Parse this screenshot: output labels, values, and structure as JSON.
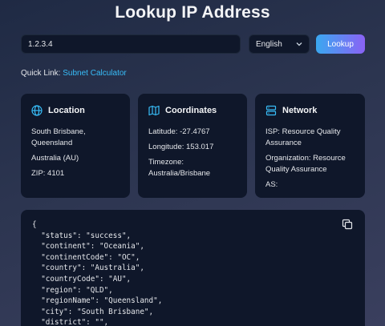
{
  "page": {
    "title": "Lookup IP Address"
  },
  "search": {
    "value": "1.2.3.4",
    "language": "English",
    "button_label": "Lookup"
  },
  "quick_link": {
    "prefix": "Quick Link:",
    "link_text": "Subnet Calculator"
  },
  "cards": {
    "location": {
      "title": "Location",
      "city_region": "South Brisbane, Queensland",
      "country": "Australia (AU)",
      "zip": "ZIP: 4101"
    },
    "coordinates": {
      "title": "Coordinates",
      "latitude": "Latitude: -27.4767",
      "longitude": "Longitude: 153.017",
      "timezone": "Timezone: Australia/Brisbane"
    },
    "network": {
      "title": "Network",
      "isp": "ISP: Resource Quality Assurance",
      "organization": "Organization: Resource Quality Assurance",
      "as": "AS:"
    }
  },
  "json_output": "{\n  \"status\": \"success\",\n  \"continent\": \"Oceania\",\n  \"continentCode\": \"OC\",\n  \"country\": \"Australia\",\n  \"countryCode\": \"AU\",\n  \"region\": \"QLD\",\n  \"regionName\": \"Queensland\",\n  \"city\": \"South Brisbane\",\n  \"district\": \"\",",
  "colors": {
    "accent": "#38bdf8",
    "card_bg": "#0f172a",
    "gradient_start": "#3aa8f0",
    "gradient_end": "#8a62f5"
  },
  "icons": {
    "location": "globe-icon",
    "coordinates": "map-icon",
    "network": "server-icon",
    "copy": "copy-icon",
    "select": "chevron-down-icon"
  }
}
